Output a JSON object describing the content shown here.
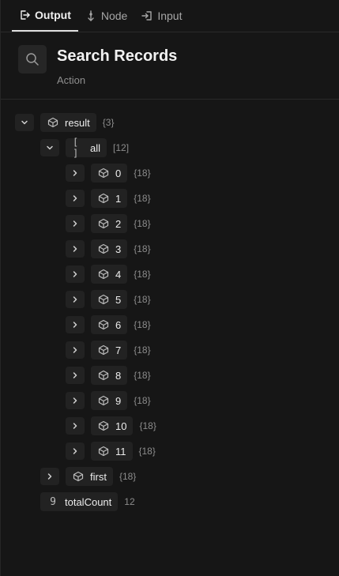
{
  "tabs": [
    {
      "label": "Output",
      "icon": "logout-icon",
      "active": true
    },
    {
      "label": "Node",
      "icon": "node-icon",
      "active": false
    },
    {
      "label": "Input",
      "icon": "login-icon",
      "active": false
    }
  ],
  "header": {
    "title": "Search Records",
    "subtitle": "Action",
    "icon": "search-icon"
  },
  "tree": {
    "result": {
      "key": "result",
      "count": "{3}"
    },
    "all": {
      "key": "all",
      "count": "[12]"
    },
    "items": [
      {
        "key": "0",
        "count": "{18}"
      },
      {
        "key": "1",
        "count": "{18}"
      },
      {
        "key": "2",
        "count": "{18}"
      },
      {
        "key": "3",
        "count": "{18}"
      },
      {
        "key": "4",
        "count": "{18}"
      },
      {
        "key": "5",
        "count": "{18}"
      },
      {
        "key": "6",
        "count": "{18}"
      },
      {
        "key": "7",
        "count": "{18}"
      },
      {
        "key": "8",
        "count": "{18}"
      },
      {
        "key": "9",
        "count": "{18}"
      },
      {
        "key": "10",
        "count": "{18}"
      },
      {
        "key": "11",
        "count": "{18}"
      }
    ],
    "first": {
      "key": "first",
      "count": "{18}"
    },
    "totalCount": {
      "key": "totalCount",
      "value": "12"
    }
  }
}
